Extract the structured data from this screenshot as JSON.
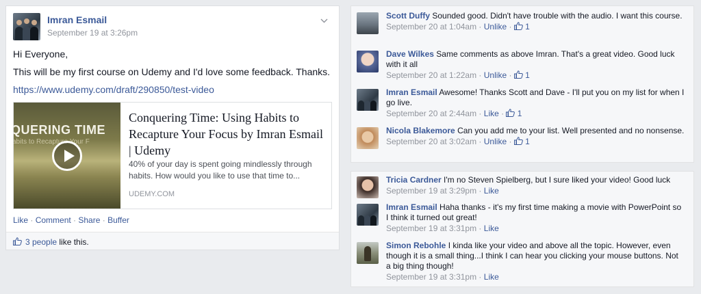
{
  "post": {
    "author": "Imran Esmail",
    "time": "September 19 at 3:26pm",
    "greeting": "Hi Everyone,",
    "body": "This will be my first course on Udemy and I'd love some feedback. Thanks.",
    "link": "https://www.udemy.com/draft/290850/test-video",
    "card": {
      "thumb_title": "QUERING TIME",
      "thumb_sub": "abits to Recapture Your F",
      "title": "Conquering Time: Using Habits to Recapture Your Focus by Imran Esmail | Udemy",
      "description": "40% of your day is spent going mindlessly through habits. How would you like to use that time to...",
      "domain": "UDEMY.COM"
    },
    "actions": {
      "like": "Like",
      "comment": "Comment",
      "share": "Share",
      "buffer": "Buffer",
      "sep": " · "
    },
    "likes": {
      "count_link": "3 people",
      "suffix": " like this."
    }
  },
  "comments_group_1": [
    {
      "name": "Scott Duffy",
      "text": "Sounded good. Didn't have trouble with the audio. I want this course.",
      "time": "September 20 at 1:04am",
      "action": "Unlike",
      "likes": "1"
    },
    {
      "name": "Dave Wilkes",
      "text": "Same comments as above Imran. That's a great video. Good luck with it all",
      "time": "September 20 at 1:22am",
      "action": "Unlike",
      "likes": "1"
    },
    {
      "name": "Imran Esmail",
      "text": "Awesome! Thanks Scott and Dave - I'll put you on my list for when I go live.",
      "time": "September 20 at 2:44am",
      "action": "Like",
      "likes": "1"
    },
    {
      "name": "Nicola Blakemore",
      "text": "Can you add me to your list. Well presented and no nonsense.",
      "time": "September 20 at 3:02am",
      "action": "Unlike",
      "likes": "1"
    }
  ],
  "comments_group_2": [
    {
      "name": "Tricia Cardner",
      "text": "I'm no Steven Spielberg, but I sure liked your video! Good luck",
      "time": "September 19 at 3:29pm",
      "action": "Like"
    },
    {
      "name": "Imran Esmail",
      "text": "Haha thanks - it's my first time making a movie with PowerPoint so I think it turned out great!",
      "time": "September 19 at 3:31pm",
      "action": "Like"
    },
    {
      "name": "Simon Rebohle",
      "text": "I kinda like your video and above all the topic. However, even though it is a small thing...I think I can hear you clicking your mouse buttons. Not a big thing though!",
      "time": "September 19 at 3:31pm",
      "action": "Like"
    }
  ],
  "sep": " · ",
  "icons": {
    "thumbs_up": "thumbs-up-icon",
    "chevron": "chevron-down-icon",
    "play": "play-icon"
  },
  "colors": {
    "link": "#3b5998",
    "muted": "#90949c",
    "background": "#e9ebee"
  }
}
